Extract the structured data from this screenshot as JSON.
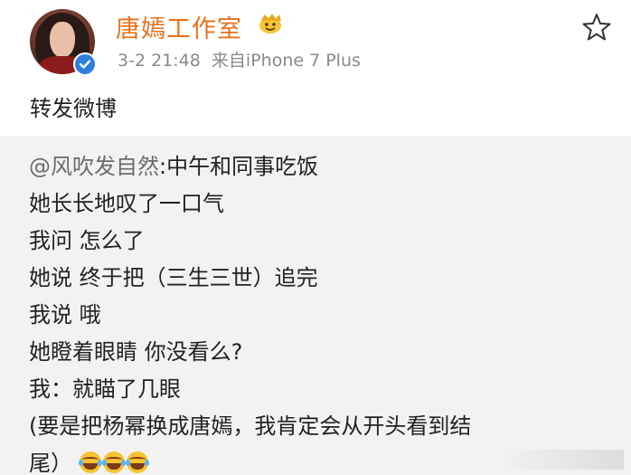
{
  "post": {
    "username": "唐嫣工作室",
    "timestamp": "3-2 21:48",
    "source": "来自iPhone 7 Plus",
    "repost_label": "转发微博",
    "favorite_icon": "star-outline-icon",
    "verified_icon": "verified-check-icon",
    "badge_icon": "crown-badge-icon"
  },
  "quoted": {
    "mention": "@风吹发自然",
    "lines": [
      ":中午和同事吃饭",
      "她长长地叹了一口气",
      "我问 怎么了",
      "她说 终于把（三生三世）追完",
      "我说 哦",
      "她瞪着眼睛 你没看么?",
      "我：就瞄了几眼",
      "(要是把杨幂换成唐嫣，我肯定会从开头看到结",
      "尾）"
    ],
    "emoji_icon": "laughing-tears-icon"
  },
  "colors": {
    "username": "#e8701c",
    "meta": "#8a8a8a",
    "quoted_bg": "#f2f2f2",
    "verified": "#2f7fd8"
  }
}
